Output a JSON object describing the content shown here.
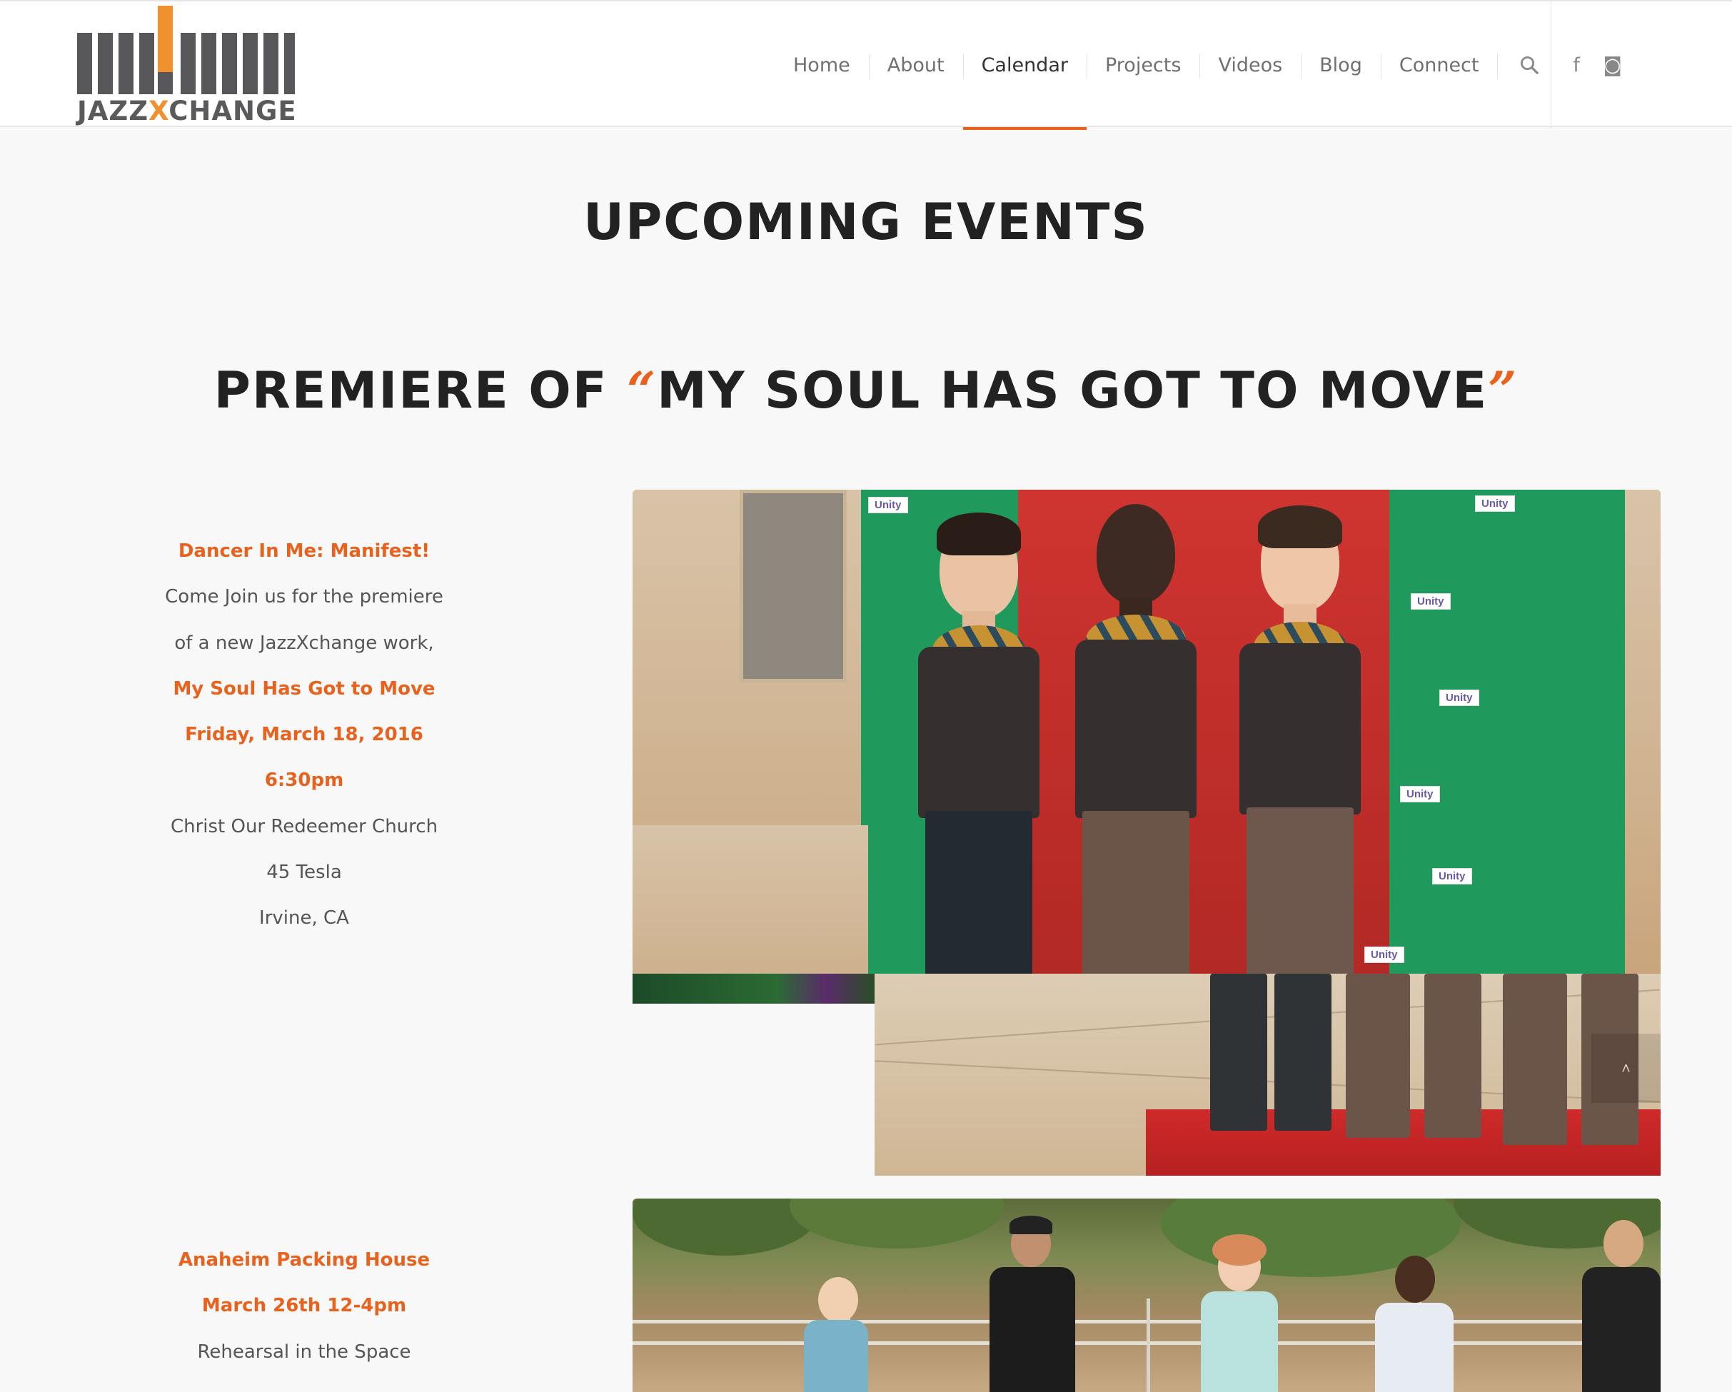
{
  "brand": {
    "logo_text_left": "JAZZ",
    "logo_text_x": "X",
    "logo_text_right": "CHANGE",
    "accent_color": "#e8621d",
    "logo_accent_color": "#f0902f",
    "logo_gray": "#57575a"
  },
  "nav": {
    "items": [
      {
        "label": "Home"
      },
      {
        "label": "About"
      },
      {
        "label": "Calendar",
        "active": true
      },
      {
        "label": "Projects"
      },
      {
        "label": "Videos"
      },
      {
        "label": "Blog"
      },
      {
        "label": "Connect"
      }
    ],
    "search_icon": "search-icon",
    "social": [
      {
        "icon": "facebook-icon",
        "glyph": "f"
      },
      {
        "icon": "instagram-icon",
        "glyph": "◙"
      }
    ]
  },
  "main": {
    "page_title": "UPCOMING EVENTS",
    "section_title": {
      "prefix": "PREMIERE OF ",
      "open_quote": "“",
      "name": "MY SOUL HAS GOT TO MOVE",
      "close_quote": "”"
    },
    "event1": {
      "lines": [
        {
          "text": "Dancer In Me: Manifest!",
          "highlight": true
        },
        {
          "text": "Come Join us for the premiere",
          "highlight": false
        },
        {
          "text": "of a new JazzXchange work,",
          "highlight": false
        },
        {
          "text": "My Soul Has Got to Move",
          "highlight": true
        },
        {
          "text": "Friday, March 18, 2016",
          "highlight": true
        },
        {
          "text": "6:30pm",
          "highlight": true
        },
        {
          "text": "Christ Our Redeemer Church",
          "highlight": false
        },
        {
          "text": "45 Tesla",
          "highlight": false
        },
        {
          "text": "Irvine, CA",
          "highlight": false
        }
      ],
      "banner_label": "Unity"
    },
    "event2": {
      "lines": [
        {
          "text": "Anaheim Packing House",
          "highlight": true
        },
        {
          "text": "March 26th 12-4pm",
          "highlight": true
        },
        {
          "text": "Rehearsal in the Space",
          "highlight": false
        }
      ]
    },
    "scroll_top_glyph": "˄"
  }
}
